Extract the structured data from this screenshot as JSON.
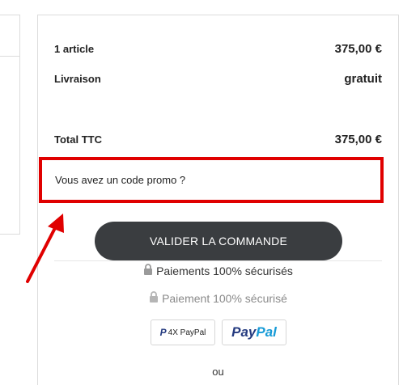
{
  "summary": {
    "articles_label": "1 article",
    "articles_value": "375,00 €",
    "shipping_label": "Livraison",
    "shipping_value": "gratuit",
    "total_label": "Total TTC",
    "total_value": "375,00 €"
  },
  "promo": {
    "text": "Vous avez un code promo ?"
  },
  "checkout": {
    "button_label": "VALIDER LA COMMANDE"
  },
  "security": {
    "line_1": "Paiements 100% sécurisés",
    "line_2": "Paiement 100% sécurisé"
  },
  "payment": {
    "paypal_4x_label": "4X PayPal",
    "paypal_label_dark": "Pay",
    "paypal_label_light": "Pal",
    "or_text": "ou"
  },
  "colors": {
    "highlight": "#e00000",
    "button_bg": "#3a3d40",
    "paypal_dark": "#253b80",
    "paypal_light": "#179bd7"
  },
  "icons": [
    "lock-icon",
    "paypal-icon",
    "arrow-icon"
  ]
}
